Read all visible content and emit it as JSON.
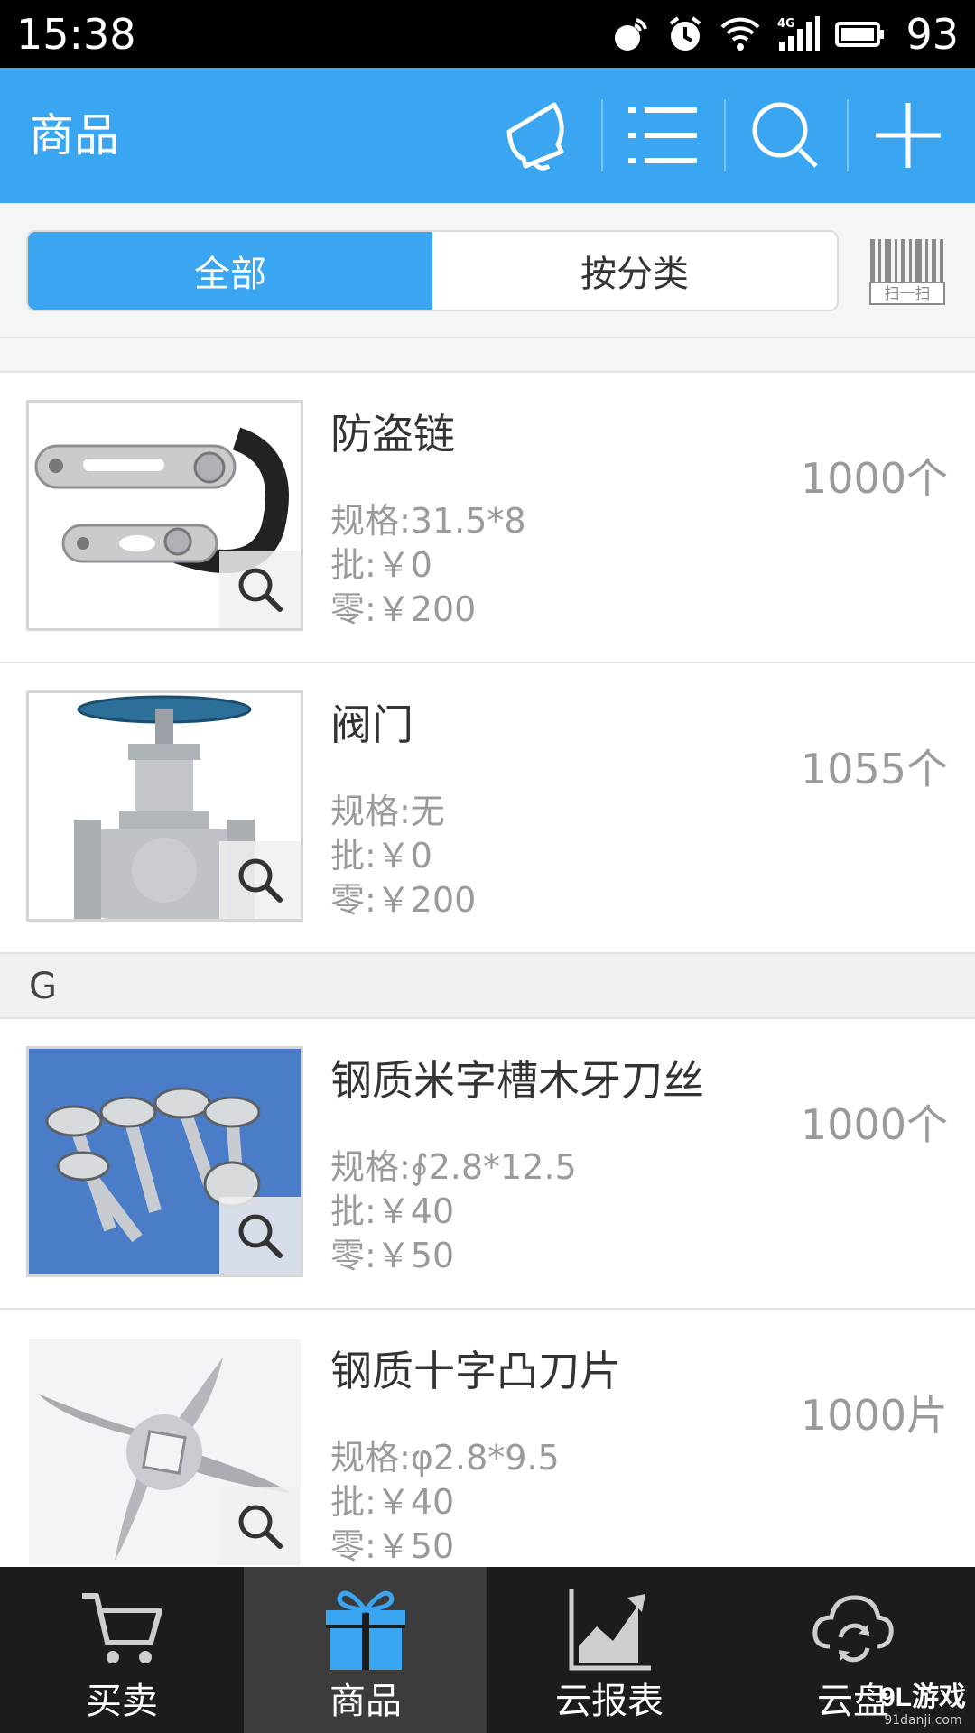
{
  "status_bar": {
    "time": "15:38",
    "network": "4G",
    "battery": "93"
  },
  "header": {
    "title": "商品",
    "actions": [
      "bell-icon",
      "list-icon",
      "search-icon",
      "plus-icon"
    ]
  },
  "filter": {
    "tabs": [
      {
        "label": "全部",
        "active": true
      },
      {
        "label": "按分类",
        "active": false
      }
    ],
    "scan_label": "扫一扫"
  },
  "products": [
    {
      "name": "防盗链",
      "spec": "规格:31.5*8",
      "wholesale": "批:￥0",
      "retail": "零:￥200",
      "qty": "1000个"
    },
    {
      "name": "阀门",
      "spec": "规格:无",
      "wholesale": "批:￥0",
      "retail": "零:￥200",
      "qty": "1055个"
    }
  ],
  "section_g": {
    "letter": "G",
    "products": [
      {
        "name": "钢质米字槽木牙刀丝",
        "spec": "规格:∮2.8*12.5",
        "wholesale": "批:￥40",
        "retail": "零:￥50",
        "qty": "1000个"
      },
      {
        "name": "钢质十字凸刀片",
        "spec": "规格:φ2.8*9.5",
        "wholesale": "批:￥40",
        "retail": "零:￥50",
        "qty": "1000片"
      }
    ]
  },
  "bottom_nav": [
    {
      "label": "买卖",
      "icon": "cart-icon",
      "active": false
    },
    {
      "label": "商品",
      "icon": "gift-icon",
      "active": true
    },
    {
      "label": "云报表",
      "icon": "chart-icon",
      "active": false
    },
    {
      "label": "云盘",
      "icon": "cloud-sync-icon",
      "active": false
    }
  ],
  "watermark": {
    "logo": "9L游戏",
    "url": "91danji.com"
  },
  "colors": {
    "accent": "#3aa6f2",
    "status_bar": "#000000",
    "nav_bg": "#1c1c1c",
    "nav_active": "#3c3c3c",
    "muted_text": "#9a9a9a"
  }
}
